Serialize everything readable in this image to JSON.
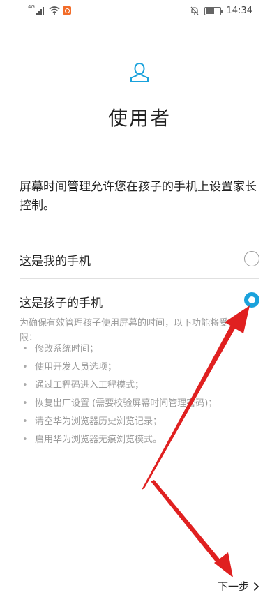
{
  "status_bar": {
    "signal_label": "4G",
    "time": "14:34",
    "battery_level": 0.6
  },
  "header": {
    "icon": "user-icon",
    "title": "使用者"
  },
  "description": "屏幕时间管理允许您在孩子的手机上设置家长控制。",
  "options": [
    {
      "label": "这是我的手机",
      "selected": false
    },
    {
      "label": "这是孩子的手机",
      "selected": true
    }
  ],
  "restrictions": {
    "intro": "为确保有效管理孩子使用屏幕的时间，以下功能将受限：",
    "items": [
      "修改系统时间；",
      "使用开发人员选项；",
      "通过工程码进入工程模式；",
      "恢复出厂设置 (需要校验屏幕时间管理密码)；",
      "清空华为浏览器历史浏览记录；",
      "启用华为浏览器无痕浏览模式。"
    ]
  },
  "footer": {
    "next_label": "下一步"
  },
  "colors": {
    "accent": "#1aa2dc",
    "annotation_arrow": "#e02020"
  }
}
